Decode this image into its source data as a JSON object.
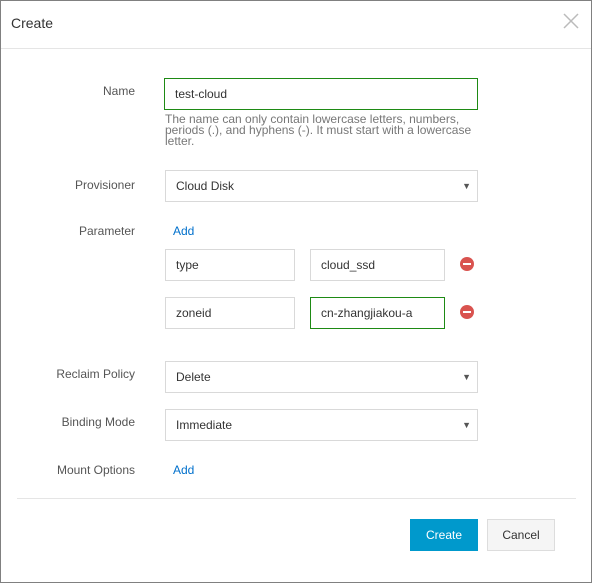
{
  "dialog": {
    "title": "Create",
    "close_icon": "close-icon"
  },
  "form": {
    "name": {
      "label": "Name",
      "value": "test-cloud",
      "hint": "The name can only contain lowercase letters, numbers, periods (.), and hyphens (-). It must start with a lowercase letter."
    },
    "provisioner": {
      "label": "Provisioner",
      "value": "Cloud Disk"
    },
    "parameter": {
      "label": "Parameter",
      "add_label": "Add",
      "rows": [
        {
          "key": "type",
          "value": "cloud_ssd"
        },
        {
          "key": "zoneid",
          "value": "cn-zhangjiakou-a"
        }
      ]
    },
    "reclaim_policy": {
      "label": "Reclaim Policy",
      "value": "Delete"
    },
    "binding_mode": {
      "label": "Binding Mode",
      "value": "Immediate"
    },
    "mount_options": {
      "label": "Mount Options",
      "add_label": "Add"
    }
  },
  "footer": {
    "create_label": "Create",
    "cancel_label": "Cancel"
  },
  "colors": {
    "primary": "#0099cc",
    "link": "#0070cc",
    "active_border": "#1e8a14",
    "remove": "#d9534f"
  },
  "icons": {
    "dropdown": "▼"
  }
}
